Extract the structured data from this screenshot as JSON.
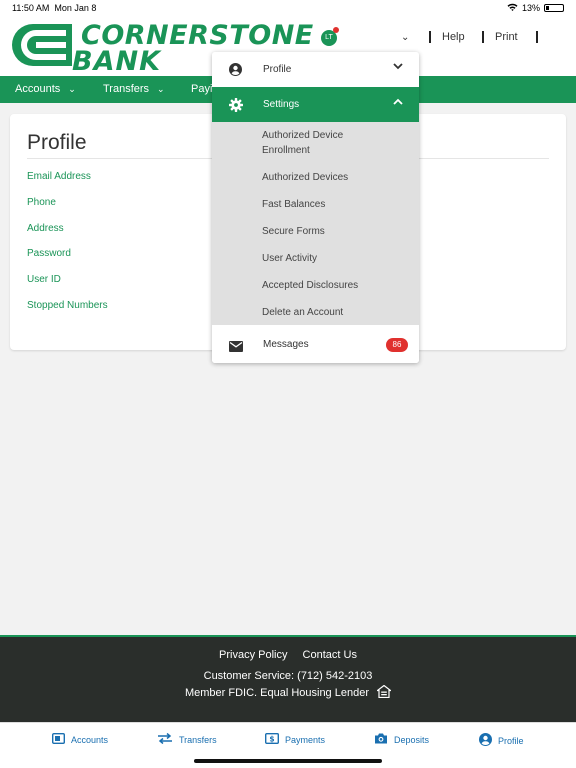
{
  "status_bar": {
    "time": "11:50 AM",
    "date": "Mon Jan 8",
    "battery": "13%"
  },
  "header": {
    "logo_line1": "CORNERSTONE",
    "logo_line2": "BANK",
    "avatar_initials": "LT",
    "help_label": "Help",
    "print_label": "Print"
  },
  "nav": {
    "items": [
      {
        "label": "Accounts"
      },
      {
        "label": "Transfers"
      },
      {
        "label": "Payi"
      }
    ]
  },
  "profile_card": {
    "title": "Profile",
    "links": [
      "Email Address",
      "Phone",
      "Address",
      "Password",
      "User ID",
      "Stopped Numbers"
    ]
  },
  "dropdown": {
    "profile_label": "Profile",
    "settings_label": "Settings",
    "settings_items": [
      "Authorized Device Enrollment",
      "Authorized Devices",
      "Fast Balances",
      "Secure Forms",
      "User Activity",
      "Accepted Disclosures",
      "Delete an Account"
    ],
    "messages_label": "Messages",
    "messages_count": "86"
  },
  "footer": {
    "privacy_label": "Privacy Policy",
    "contact_label": "Contact Us",
    "customer_service": "Customer Service: (712) 542-2103",
    "fdic": "Member FDIC. Equal Housing Lender"
  },
  "tabbar": {
    "items": [
      {
        "label": "Accounts",
        "icon": "wallet-icon"
      },
      {
        "label": "Transfers",
        "icon": "transfer-arrows-icon"
      },
      {
        "label": "Payments",
        "icon": "dollar-bill-icon"
      },
      {
        "label": "Deposits",
        "icon": "camera-icon"
      },
      {
        "label": "Profile",
        "icon": "user-circle-icon"
      }
    ]
  },
  "colors": {
    "brand_green": "#1a9457",
    "badge_red": "#e0312e",
    "tab_blue": "#1a6fb0",
    "footer_bg": "#2a2e2b"
  }
}
